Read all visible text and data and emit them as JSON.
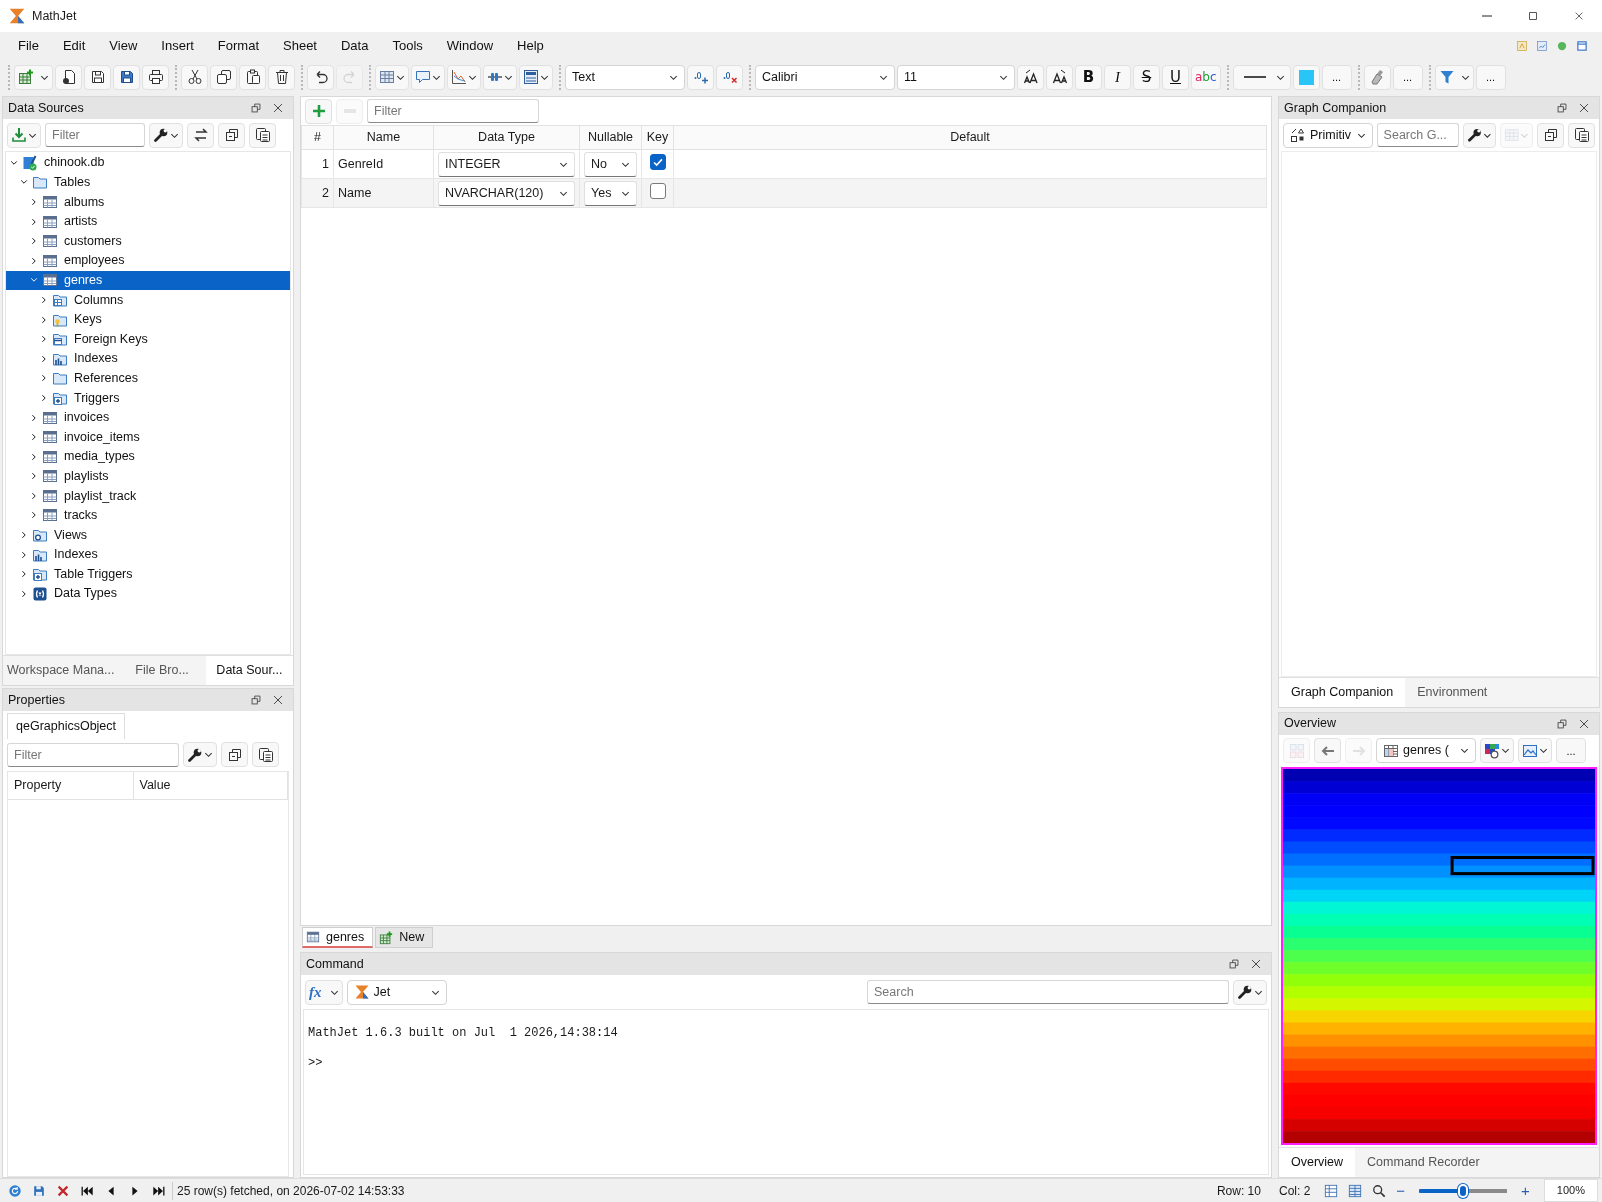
{
  "window": {
    "title": "MathJet"
  },
  "menu": [
    "File",
    "Edit",
    "View",
    "Insert",
    "Format",
    "Sheet",
    "Data",
    "Tools",
    "Window",
    "Help"
  ],
  "toolbar": [
    [
      {
        "kind": "split",
        "disabled": false
      },
      {
        "kind": "icon",
        "disabled": false
      },
      {
        "kind": "icon",
        "disabled": false
      },
      {
        "kind": "icon",
        "disabled": false
      },
      {
        "kind": "icon",
        "disabled": false
      }
    ],
    [
      {
        "kind": "icon",
        "disabled": false
      },
      {
        "kind": "icon",
        "disabled": false
      },
      {
        "kind": "icon",
        "disabled": false
      },
      {
        "kind": "icon",
        "disabled": false
      }
    ],
    [
      {
        "kind": "icon",
        "disabled": false
      },
      {
        "kind": "icon",
        "disabled": true
      }
    ],
    [
      {
        "kind": "icon-menu",
        "disabled": false
      },
      {
        "kind": "icon-menu",
        "disabled": false
      },
      {
        "kind": "icon-menu",
        "disabled": false
      },
      {
        "kind": "icon-menu",
        "disabled": false
      },
      {
        "kind": "icon-menu",
        "disabled": false
      }
    ],
    [
      {
        "kind": "select",
        "value": "Text",
        "disabled": false
      },
      {
        "kind": "icon",
        "disabled": false
      },
      {
        "kind": "icon",
        "disabled": false
      }
    ],
    [
      {
        "kind": "select",
        "value": "Calibri",
        "disabled": false
      },
      {
        "kind": "select",
        "value": "11",
        "disabled": false
      },
      {
        "kind": "icon",
        "disabled": false
      },
      {
        "kind": "icon",
        "disabled": false
      },
      {
        "kind": "glyph",
        "label": "B",
        "disabled": false
      },
      {
        "kind": "glyph",
        "label": "I",
        "disabled": false
      },
      {
        "kind": "glyph",
        "label": "S",
        "disabled": false
      },
      {
        "kind": "glyph",
        "label": "U",
        "disabled": false
      },
      {
        "kind": "glyph",
        "label": "abc",
        "disabled": false
      }
    ],
    [
      {
        "kind": "line-style",
        "disabled": false
      },
      {
        "kind": "swatch",
        "color": "#29c5f6",
        "disabled": false
      },
      {
        "kind": "more",
        "label": "...",
        "disabled": false
      }
    ],
    [
      {
        "kind": "icon",
        "disabled": false
      },
      {
        "kind": "more",
        "label": "...",
        "disabled": false
      }
    ],
    [
      {
        "kind": "split",
        "disabled": false
      },
      {
        "kind": "more",
        "label": "...",
        "disabled": false
      }
    ]
  ],
  "data_sources": {
    "title": "Data Sources",
    "toolbar": [
      {
        "kind": "icon-menu",
        "disabled": false
      },
      {
        "kind": "search",
        "placeholder": "Filter",
        "disabled": false
      },
      {
        "kind": "icon-menu",
        "disabled": false
      },
      {
        "kind": "icon",
        "disabled": false
      },
      {
        "kind": "icon",
        "disabled": false
      },
      {
        "kind": "icon",
        "disabled": false
      }
    ],
    "tree": [
      {
        "label": "chinook.db",
        "kind": "database",
        "expanded": true,
        "selected": false,
        "children": [
          {
            "label": "Tables",
            "kind": "folder",
            "expanded": true,
            "selected": false,
            "children": [
              {
                "label": "albums",
                "kind": "table",
                "expanded": false,
                "selected": false
              },
              {
                "label": "artists",
                "kind": "table",
                "expanded": false,
                "selected": false
              },
              {
                "label": "customers",
                "kind": "table",
                "expanded": false,
                "selected": false
              },
              {
                "label": "employees",
                "kind": "table",
                "expanded": false,
                "selected": false
              },
              {
                "label": "genres",
                "kind": "table",
                "expanded": true,
                "selected": true,
                "children": [
                  {
                    "label": "Columns",
                    "kind": "columns",
                    "expanded": false,
                    "selected": false
                  },
                  {
                    "label": "Keys",
                    "kind": "keys",
                    "expanded": false,
                    "selected": false
                  },
                  {
                    "label": "Foreign Keys",
                    "kind": "foreign-keys",
                    "expanded": false,
                    "selected": false
                  },
                  {
                    "label": "Indexes",
                    "kind": "indexes",
                    "expanded": false,
                    "selected": false
                  },
                  {
                    "label": "References",
                    "kind": "references",
                    "expanded": false,
                    "selected": false
                  },
                  {
                    "label": "Triggers",
                    "kind": "triggers",
                    "expanded": false,
                    "selected": false
                  }
                ]
              },
              {
                "label": "invoices",
                "kind": "table",
                "expanded": false,
                "selected": false
              },
              {
                "label": "invoice_items",
                "kind": "table",
                "expanded": false,
                "selected": false
              },
              {
                "label": "media_types",
                "kind": "table",
                "expanded": false,
                "selected": false
              },
              {
                "label": "playlists",
                "kind": "table",
                "expanded": false,
                "selected": false
              },
              {
                "label": "playlist_track",
                "kind": "table",
                "expanded": false,
                "selected": false
              },
              {
                "label": "tracks",
                "kind": "table",
                "expanded": false,
                "selected": false
              }
            ]
          },
          {
            "label": "Views",
            "kind": "views",
            "expanded": false,
            "selected": false
          },
          {
            "label": "Indexes",
            "kind": "indexes",
            "expanded": false,
            "selected": false
          },
          {
            "label": "Table Triggers",
            "kind": "triggers",
            "expanded": false,
            "selected": false
          },
          {
            "label": "Data Types",
            "kind": "data-types",
            "expanded": false,
            "selected": false
          }
        ]
      }
    ],
    "tabs": [
      {
        "label": "Workspace Mana...",
        "selected": false
      },
      {
        "label": "File Bro...",
        "selected": false
      },
      {
        "label": "Data Sour...",
        "selected": true
      }
    ]
  },
  "properties": {
    "title": "Properties",
    "tabs": [
      {
        "label": "qeGraphicsObject",
        "selected": true
      }
    ],
    "toolbar": [
      {
        "kind": "search",
        "placeholder": "Filter",
        "disabled": false
      },
      {
        "kind": "icon-menu",
        "disabled": false
      },
      {
        "kind": "icon",
        "disabled": false
      },
      {
        "kind": "icon",
        "disabled": false
      }
    ],
    "columns": [
      "Property",
      "Value"
    ]
  },
  "editor": {
    "toolbar": [
      {
        "kind": "icon",
        "disabled": false
      },
      {
        "kind": "icon",
        "disabled": true
      },
      {
        "kind": "search",
        "placeholder": "Filter",
        "disabled": false
      }
    ],
    "columns": [
      "#",
      "Name",
      "Data Type",
      "Nullable",
      "Key",
      "Default"
    ],
    "rows": [
      {
        "index": "1",
        "name": "GenreId",
        "data_type": "INTEGER",
        "nullable": "No",
        "key": true
      },
      {
        "index": "2",
        "name": "Name",
        "data_type": "NVARCHAR(120)",
        "nullable": "Yes",
        "key": false
      }
    ],
    "tabs": [
      {
        "label": "genres",
        "kind": "table",
        "selected": true
      },
      {
        "label": "New",
        "kind": "new",
        "selected": false
      }
    ]
  },
  "command": {
    "title": "Command",
    "toolbar": [
      {
        "kind": "glyph-menu",
        "label": "fx",
        "disabled": false
      },
      {
        "kind": "icon-select",
        "value": "Jet",
        "disabled": false
      },
      {
        "kind": "search",
        "placeholder": "Search",
        "disabled": false
      },
      {
        "kind": "icon-menu",
        "disabled": false
      }
    ],
    "output": [
      "MathJet 1.6.3 built on Jul  1 2026,14:38:14",
      ">>"
    ]
  },
  "graph_companion": {
    "title": "Graph Companion",
    "toolbar": [
      {
        "kind": "icon-select",
        "value": "Primitiv",
        "disabled": false
      },
      {
        "kind": "search",
        "placeholder": "Search G...",
        "disabled": false
      },
      {
        "kind": "icon-menu",
        "disabled": false
      },
      {
        "kind": "icon-menu",
        "disabled": true
      },
      {
        "kind": "icon",
        "disabled": false
      },
      {
        "kind": "icon",
        "disabled": false
      }
    ],
    "tabs": [
      {
        "label": "Graph Companion",
        "selected": true
      },
      {
        "label": "Environment",
        "selected": false
      }
    ]
  },
  "overview": {
    "title": "Overview",
    "toolbar": [
      {
        "kind": "icon",
        "disabled": true
      },
      {
        "kind": "icon",
        "disabled": false
      },
      {
        "kind": "icon",
        "disabled": true
      },
      {
        "kind": "icon-select",
        "value": "genres (",
        "disabled": false
      },
      {
        "kind": "icon-menu",
        "disabled": false
      },
      {
        "kind": "icon-menu",
        "disabled": false
      },
      {
        "kind": "more",
        "label": "...",
        "disabled": false
      }
    ],
    "tabs": [
      {
        "label": "Overview",
        "selected": true
      },
      {
        "label": "Command Recorder",
        "selected": false
      }
    ]
  },
  "status_bar": {
    "left_tools": [
      {
        "kind": "icon",
        "disabled": false
      },
      {
        "kind": "icon",
        "disabled": false
      },
      {
        "kind": "icon",
        "disabled": false
      },
      {
        "kind": "icon",
        "disabled": false
      },
      {
        "kind": "icon",
        "disabled": false
      },
      {
        "kind": "icon",
        "disabled": false
      },
      {
        "kind": "icon",
        "disabled": false
      }
    ],
    "message": "25 row(s) fetched, on 2026-07-02 14:53:33",
    "row": "Row: 10",
    "col": "Col: 2",
    "right_tools": [
      {
        "kind": "icon",
        "disabled": false
      },
      {
        "kind": "icon",
        "disabled": false
      },
      {
        "kind": "icon",
        "disabled": false
      }
    ],
    "zoom_out": "−",
    "zoom": {
      "level": 0.5
    },
    "zoom_in": "+",
    "zoom_label": "100%"
  }
}
